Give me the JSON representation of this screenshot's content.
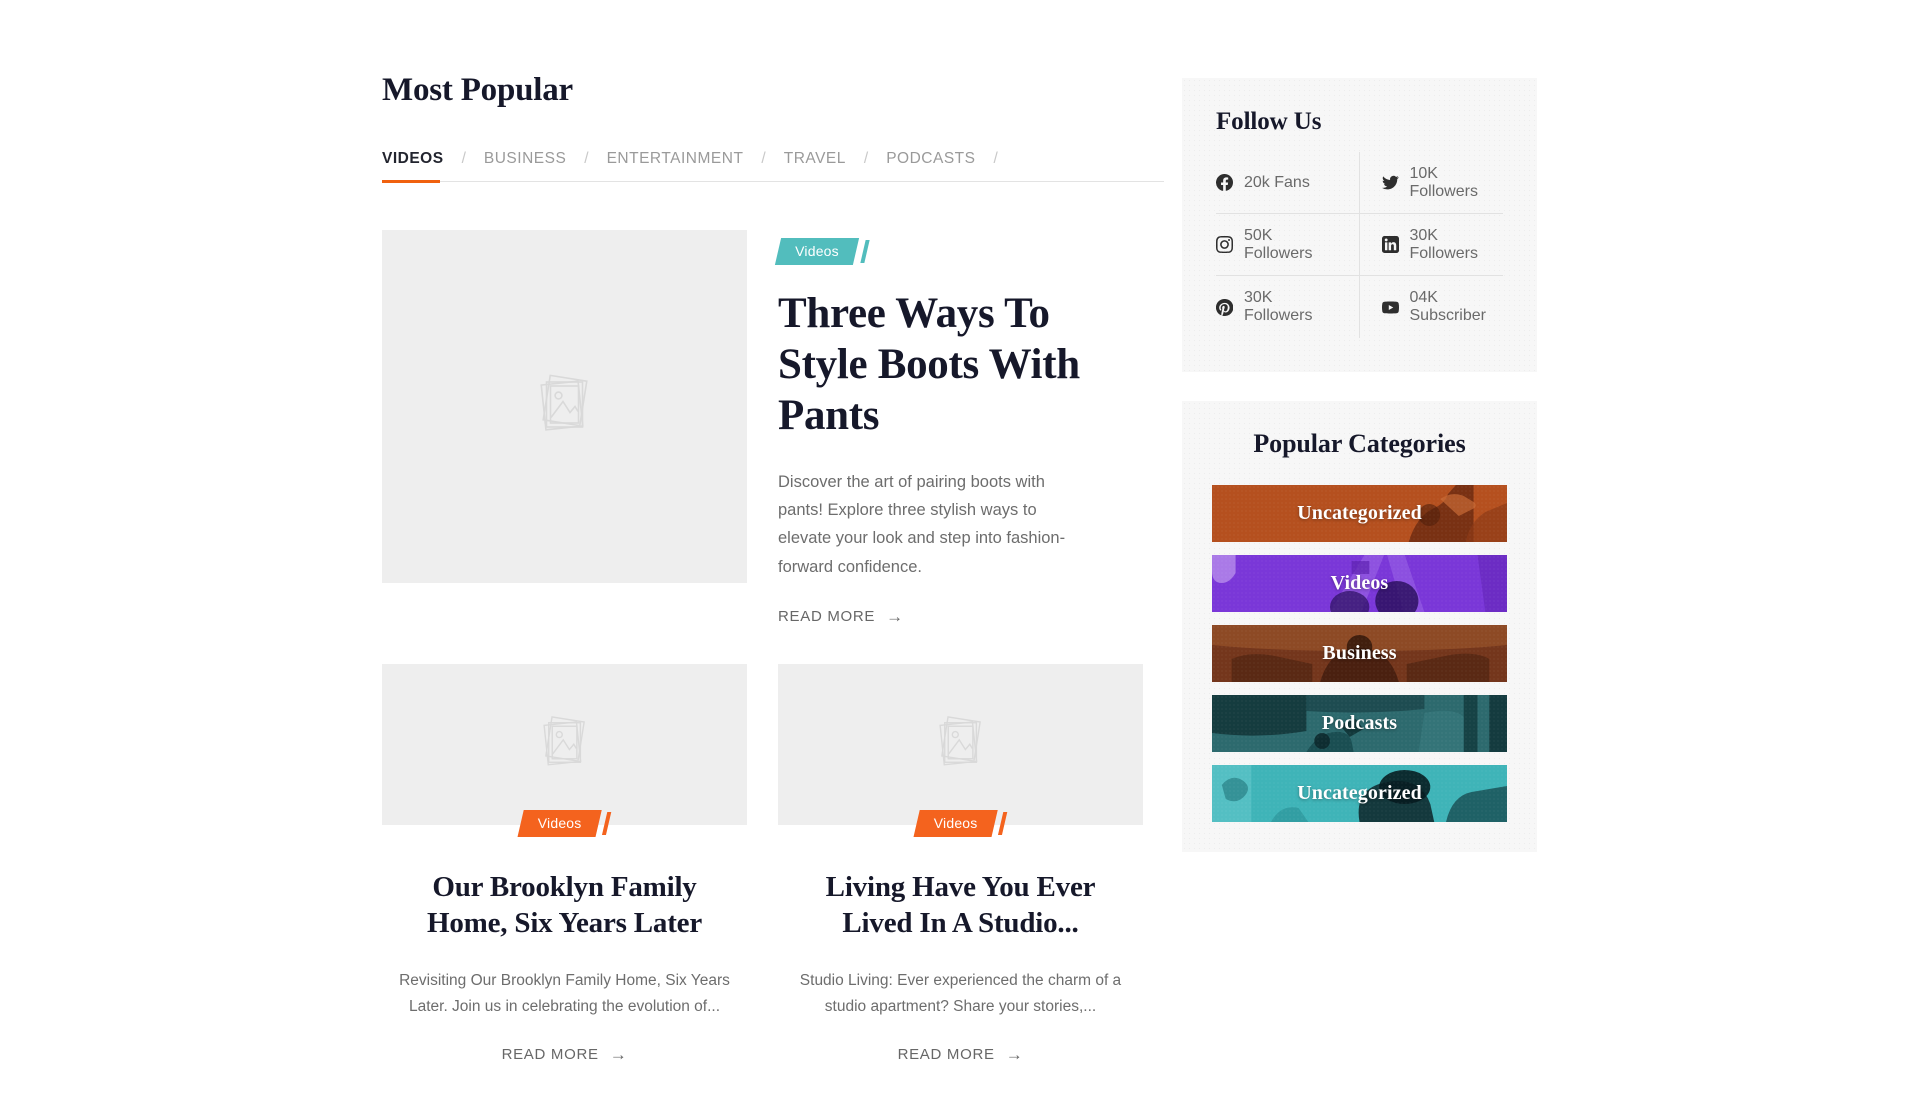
{
  "main": {
    "section_title": "Most Popular",
    "tabs": [
      {
        "label": "VIDEOS",
        "active": true
      },
      {
        "label": "BUSINESS",
        "active": false
      },
      {
        "label": "ENTERTAINMENT",
        "active": false
      },
      {
        "label": "TRAVEL",
        "active": false
      },
      {
        "label": "PODCASTS",
        "active": false
      }
    ],
    "tab_separator": "/",
    "accent_color": "#f0610f",
    "featured": {
      "badge": "Videos",
      "badge_color": "#52bdbd",
      "title": "Three Ways To Style Boots With Pants",
      "excerpt": "Discover the art of pairing boots with pants! Explore three stylish ways to elevate your look and step into fashion-forward confidence.",
      "read_more": "READ MORE",
      "arrow": "→",
      "image_placeholder": "image-placeholder-icon"
    },
    "cards": [
      {
        "badge": "Videos",
        "badge_color": "#f4631e",
        "title": "Our Brooklyn Family Home, Six Years Later",
        "excerpt": "Revisiting Our Brooklyn Family Home, Six Years Later. Join us in celebrating the evolution of...",
        "read_more": "READ MORE",
        "arrow": "→"
      },
      {
        "badge": "Videos",
        "badge_color": "#f4631e",
        "title": "Living Have You Ever Lived In A Studio...",
        "excerpt": "Studio Living: Ever experienced the charm of a studio apartment? Share your stories,...",
        "read_more": "READ MORE",
        "arrow": "→"
      }
    ]
  },
  "sidebar": {
    "follow": {
      "title": "Follow Us",
      "items": [
        {
          "icon": "facebook-icon",
          "label": "20k Fans"
        },
        {
          "icon": "twitter-icon",
          "label": "10K Followers"
        },
        {
          "icon": "instagram-icon",
          "label": "50K Followers"
        },
        {
          "icon": "linkedin-icon",
          "label": "30K Followers"
        },
        {
          "icon": "pinterest-icon",
          "label": "30K Followers"
        },
        {
          "icon": "youtube-icon",
          "label": "04K Subscriber"
        }
      ]
    },
    "categories": {
      "title": "Popular Categories",
      "items": [
        {
          "label": "Uncategorized",
          "color": "#b5501f"
        },
        {
          "label": "Videos",
          "color": "#7a37d8"
        },
        {
          "label": "Business",
          "color": "#74361c"
        },
        {
          "label": "Podcasts",
          "color": "#2d6a6e"
        },
        {
          "label": "Uncategorized",
          "color": "#3fb4b8"
        }
      ]
    }
  }
}
